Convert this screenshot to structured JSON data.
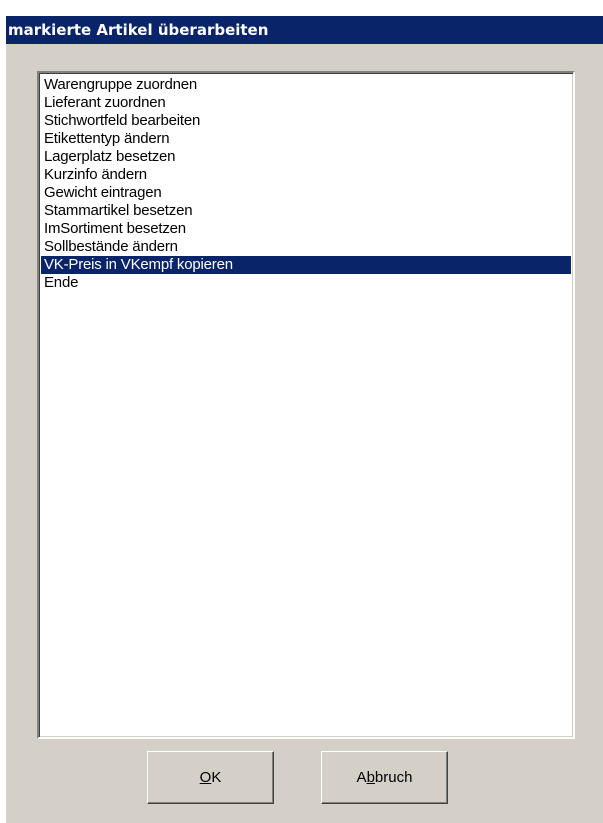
{
  "dialog": {
    "title": "markierte Artikel überarbeiten"
  },
  "list": {
    "items": [
      {
        "label": "Warengruppe zuordnen"
      },
      {
        "label": "Lieferant zuordnen"
      },
      {
        "label": "Stichwortfeld bearbeiten"
      },
      {
        "label": "Etikettentyp ändern"
      },
      {
        "label": "Lagerplatz besetzen"
      },
      {
        "label": "Kurzinfo ändern"
      },
      {
        "label": "Gewicht eintragen"
      },
      {
        "label": "Stammartikel besetzen"
      },
      {
        "label": "ImSortiment besetzen"
      },
      {
        "label": "Sollbestände ändern"
      },
      {
        "label": "VK-Preis in VKempf kopieren"
      },
      {
        "label": "Ende"
      }
    ],
    "selected_index": 10
  },
  "buttons": {
    "ok": {
      "mnemonic": "O",
      "rest": "K"
    },
    "cancel": {
      "pre": "A",
      "mnemonic": "b",
      "rest": "bruch"
    }
  },
  "colors": {
    "title_bg": "#0a246a",
    "selection_bg": "#0a246a",
    "dialog_bg": "#d4d0c8"
  }
}
